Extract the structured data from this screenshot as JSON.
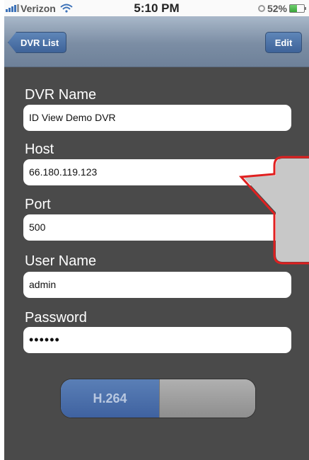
{
  "status": {
    "carrier": "Verizon",
    "time": "5:10 PM",
    "battery_text": "52%"
  },
  "nav": {
    "back_label": "DVR List",
    "edit_label": "Edit"
  },
  "form": {
    "dvr_name_label": "DVR Name",
    "dvr_name_value": "ID View Demo DVR",
    "host_label": "Host",
    "host_value": "66.180.119.123",
    "port_label": "Port",
    "port_value": "500",
    "user_label": "User Name",
    "user_value": "admin",
    "password_label": "Password",
    "password_value": "••••••"
  },
  "toggle": {
    "on_label": "H.264"
  },
  "colors": {
    "accent": "#3e6399",
    "callout": "#e02020"
  }
}
